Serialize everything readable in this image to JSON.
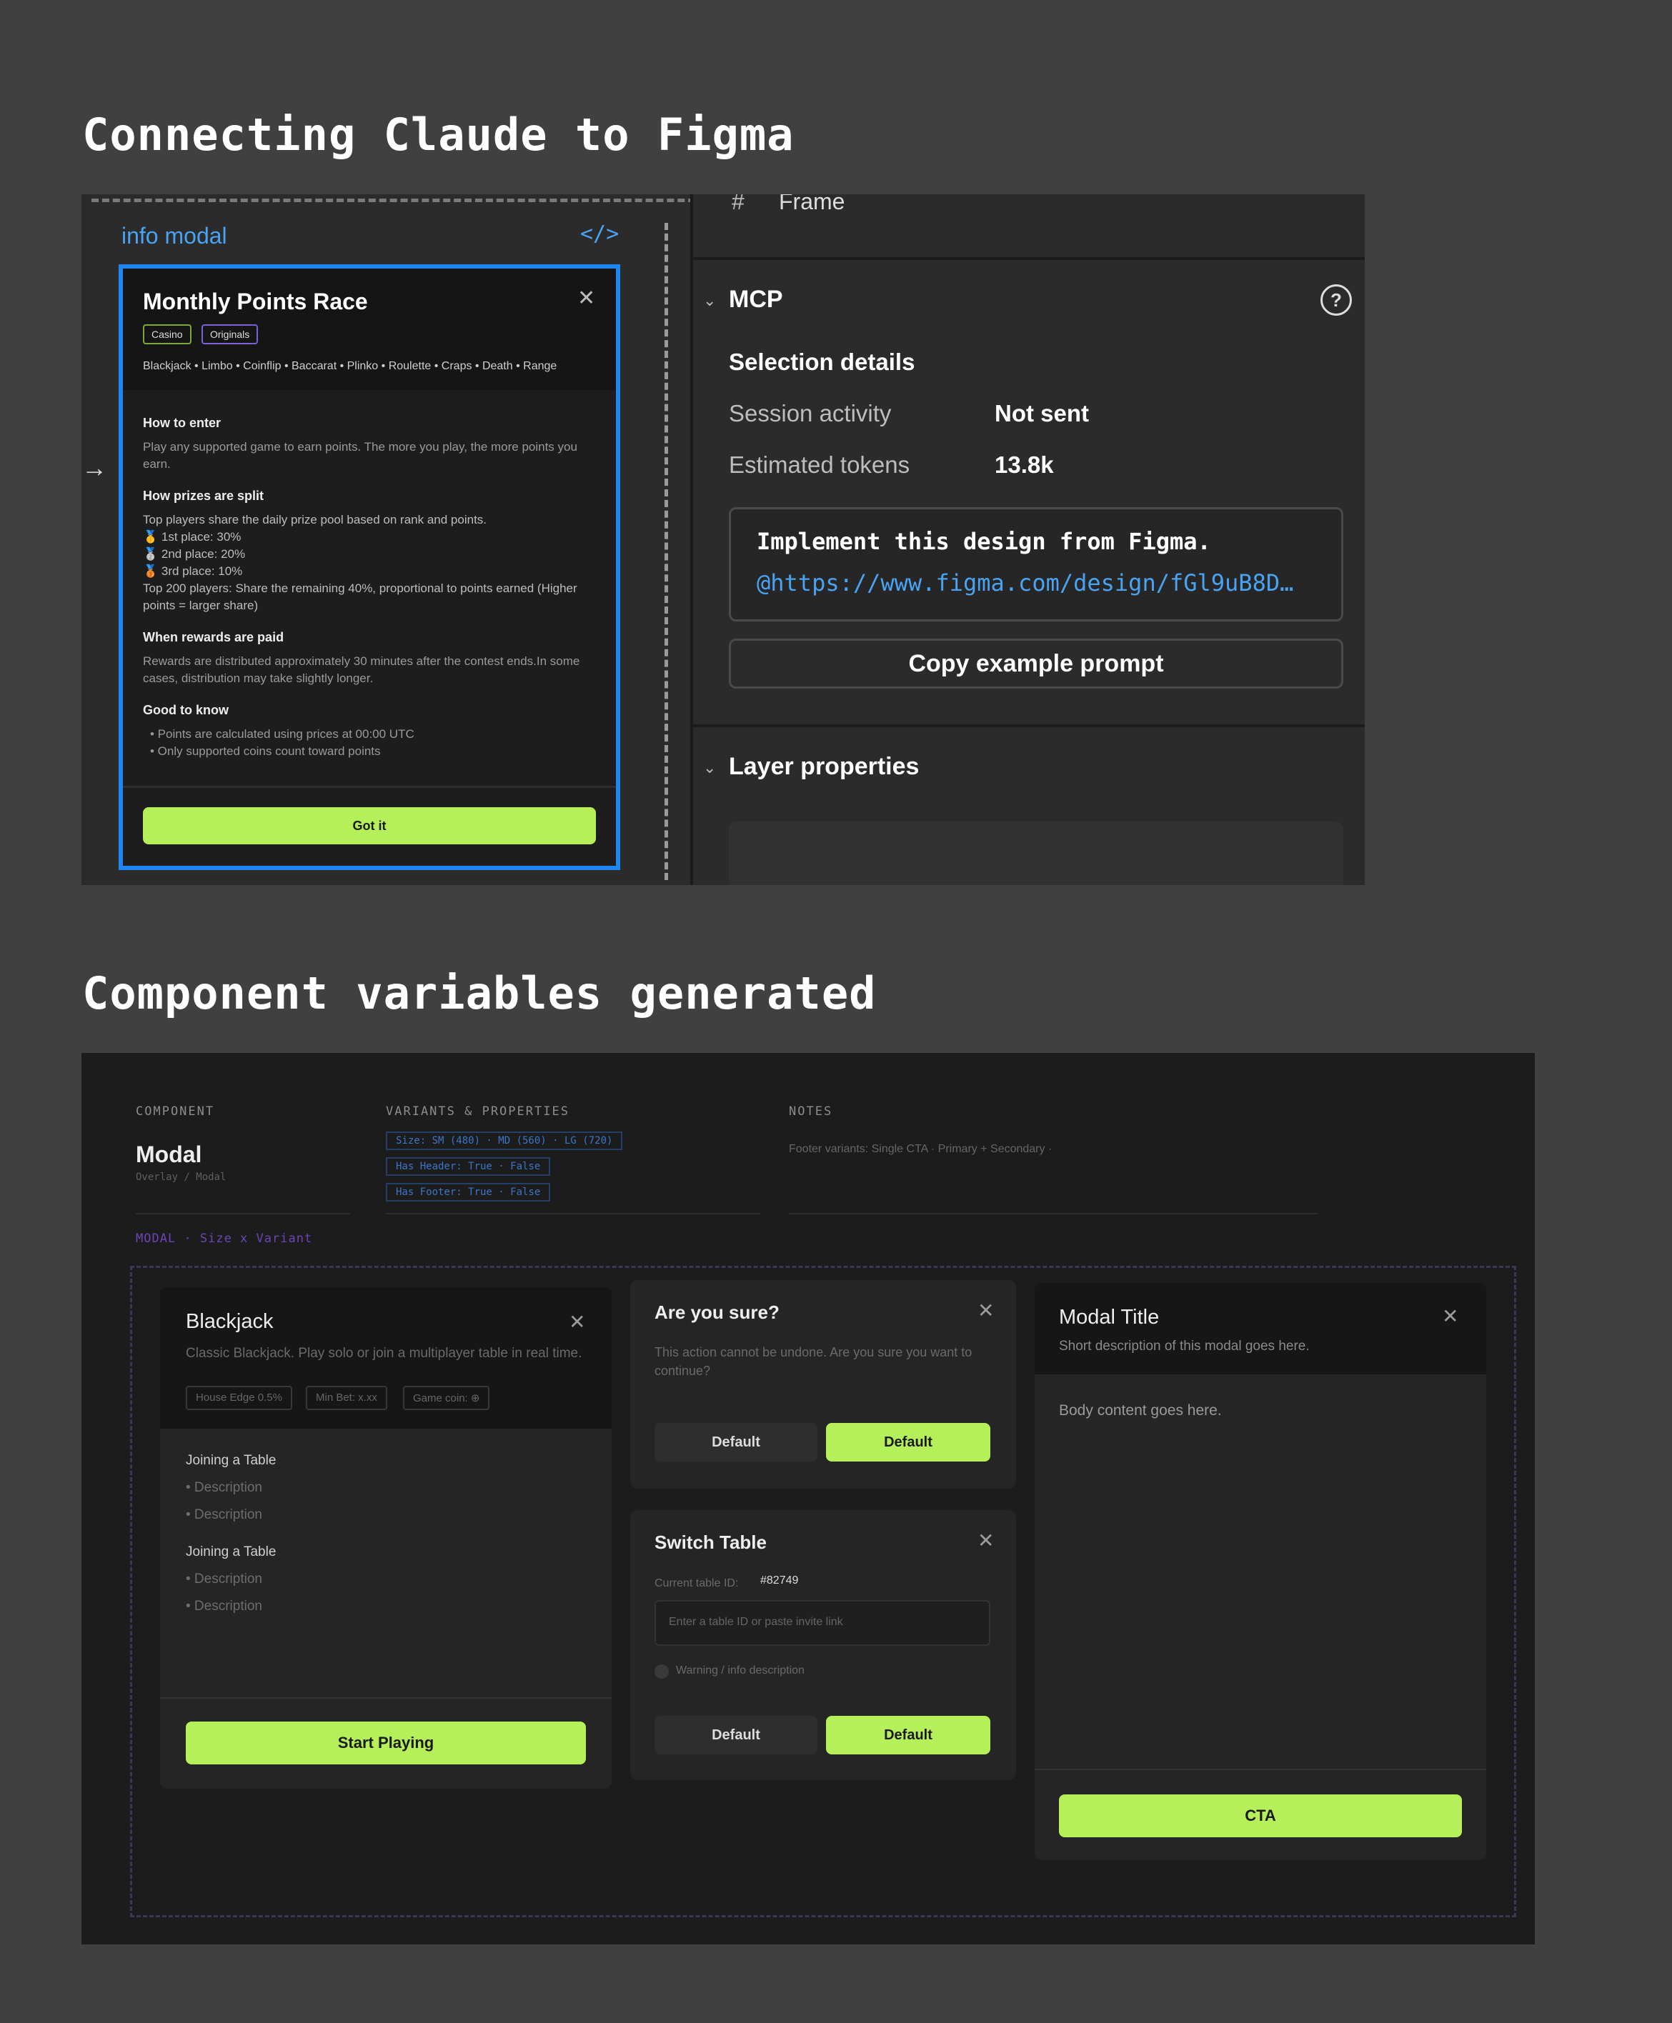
{
  "section1": {
    "heading": "Connecting Claude to Figma"
  },
  "figma": {
    "left": {
      "label": "info modal",
      "code_icon": "</>",
      "modal": {
        "title": "Monthly Points Race",
        "tags": [
          "Casino",
          "Originals"
        ],
        "games": "Blackjack • Limbo • Coinflip • Baccarat • Plinko • Roulette • Craps • Death • Range",
        "how_to_enter": {
          "heading": "How to enter",
          "text": "Play any supported game to earn points. The more you play, the more points you earn."
        },
        "prizes": {
          "heading": "How prizes are split",
          "intro": "Top players share the daily prize pool based on rank and points.",
          "first": "🥇 1st place: 30%",
          "second": "🥈 2nd place: 20%",
          "third": "🥉 3rd place: 10%",
          "rest": "Top 200 players: Share the remaining 40%, proportional to points earned (Higher points = larger share)"
        },
        "rewards": {
          "heading": "When rewards are paid",
          "text": "Rewards are distributed approximately 30 minutes after the contest ends.In some cases, distribution may take slightly longer."
        },
        "good": {
          "heading": "Good to know",
          "item1": "• Points are calculated using prices at 00:00 UTC",
          "item2": "• Only supported coins count toward points"
        },
        "button": "Got it"
      }
    },
    "right": {
      "frame_label": "Frame",
      "mcp_title": "MCP",
      "selection_details": "Selection details",
      "session_activity_label": "Session activity",
      "session_activity_value": "Not sent",
      "estimated_tokens_label": "Estimated tokens",
      "estimated_tokens_value": "13.8k",
      "prompt_line1": "Implement this design from Figma.",
      "prompt_line2": "@https://www.figma.com/design/fGl9uB8D…",
      "copy_button": "Copy example prompt",
      "layer_properties": "Layer properties"
    }
  },
  "section2": {
    "heading": "Component variables generated"
  },
  "component": {
    "component_caption": "COMPONENT",
    "name": "Modal",
    "path": "Overlay / Modal",
    "variants_caption": "VARIANTS & PROPERTIES",
    "chips": [
      "Size: SM (480) · MD (560) · LG (720)",
      "Has Header: True · False",
      "Has Footer: True · False"
    ],
    "notes_caption": "NOTES",
    "notes_text": "Footer variants: Single CTA · Primary + Secondary ·",
    "breadcrumb": "MODAL  ·  Size x Variant",
    "blackjack": {
      "title": "Blackjack",
      "desc": "Classic Blackjack. Play solo or join a multiplayer table in real time.",
      "pills": [
        "House Edge 0.5%",
        "Min Bet: x.xx",
        "Game coin: ⊕"
      ],
      "group1_heading": "Joining a Table",
      "group1_items": [
        "• Description",
        "• Description"
      ],
      "group2_heading": "Joining a Table",
      "group2_items": [
        "• Description",
        "• Description"
      ],
      "button": "Start Playing"
    },
    "confirm": {
      "title": "Are you sure?",
      "text": "This action cannot be undone. Are you sure you want to continue?",
      "secondary": "Default",
      "primary": "Default"
    },
    "switch": {
      "title": "Switch Table",
      "current_label": "Current table ID:",
      "current_value": "#82749",
      "placeholder": "Enter a table ID or paste invite link",
      "warning": "Warning / info description",
      "secondary": "Default",
      "primary": "Default"
    },
    "generic": {
      "title": "Modal Title",
      "desc": "Short description of this modal goes here.",
      "body": "Body content goes here.",
      "button": "CTA"
    }
  }
}
